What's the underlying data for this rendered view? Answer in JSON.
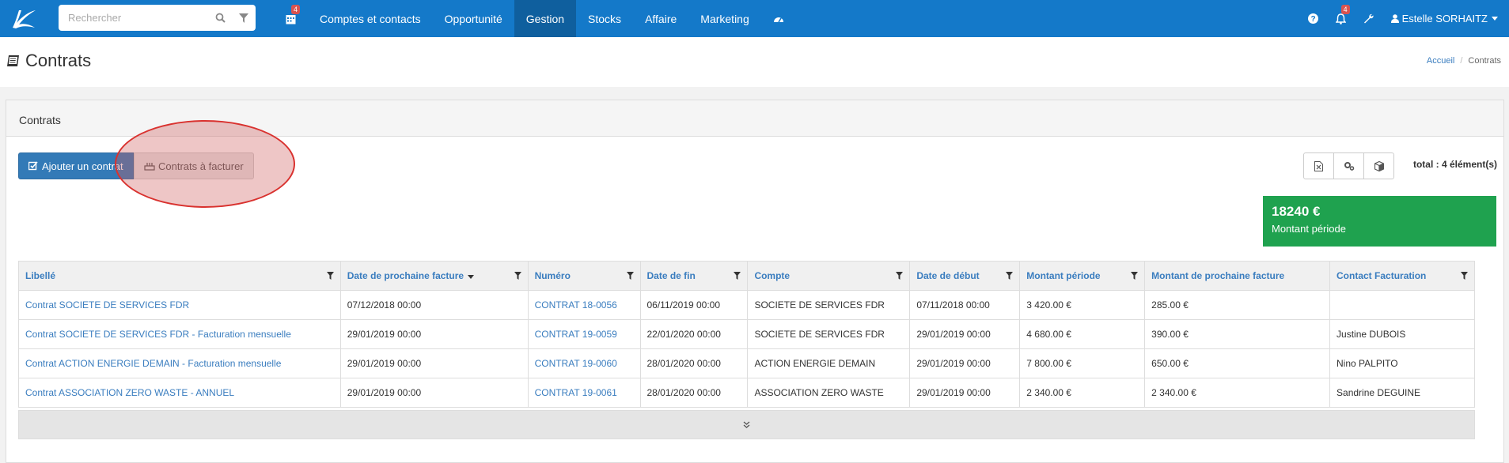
{
  "search": {
    "placeholder": "Rechercher"
  },
  "nav": {
    "calendar_badge": "4",
    "items": [
      {
        "label": "Comptes et contacts"
      },
      {
        "label": "Opportunité"
      },
      {
        "label": "Gestion"
      },
      {
        "label": "Stocks"
      },
      {
        "label": "Affaire"
      },
      {
        "label": "Marketing"
      }
    ]
  },
  "right_nav": {
    "notifications_badge": "4",
    "user_name": "Estelle SORHAITZ"
  },
  "page": {
    "title": "Contrats"
  },
  "breadcrumb": {
    "home": "Accueil",
    "current": "Contrats"
  },
  "panel": {
    "title": "Contrats"
  },
  "toolbar": {
    "add_label": "Ajouter un contrat",
    "bill_label": "Contrats à facturer",
    "total": "total : 4 élément(s)"
  },
  "stat": {
    "value": "18240 €",
    "label": "Montant période"
  },
  "table": {
    "headers": [
      "Libellé",
      "Date de prochaine facture",
      "Numéro",
      "Date de fin",
      "Compte",
      "Date de début",
      "Montant période",
      "Montant de prochaine facture",
      "Contact Facturation"
    ],
    "rows": [
      [
        "Contrat SOCIETE DE SERVICES FDR",
        "07/12/2018 00:00",
        "CONTRAT 18-0056",
        "06/11/2019 00:00",
        "SOCIETE DE SERVICES FDR",
        "07/11/2018 00:00",
        "3 420.00 €",
        "285.00 €",
        ""
      ],
      [
        "Contrat SOCIETE DE SERVICES FDR - Facturation mensuelle",
        "29/01/2019 00:00",
        "CONTRAT 19-0059",
        "22/01/2020 00:00",
        "SOCIETE DE SERVICES FDR",
        "29/01/2019 00:00",
        "4 680.00 €",
        "390.00 €",
        "Justine DUBOIS"
      ],
      [
        "Contrat ACTION ENERGIE DEMAIN - Facturation mensuelle",
        "29/01/2019 00:00",
        "CONTRAT 19-0060",
        "28/01/2020 00:00",
        "ACTION ENERGIE DEMAIN",
        "29/01/2019 00:00",
        "7 800.00 €",
        "650.00 €",
        "Nino PALPITO"
      ],
      [
        "Contrat ASSOCIATION ZERO WASTE - ANNUEL",
        "29/01/2019 00:00",
        "CONTRAT 19-0061",
        "28/01/2020 00:00",
        "ASSOCIATION ZERO WASTE",
        "29/01/2019 00:00",
        "2 340.00 €",
        "2 340.00 €",
        "Sandrine DEGUINE"
      ]
    ]
  },
  "colors": {
    "topbar": "#1479c9",
    "active_nav": "#0f5f9e",
    "primary_button": "#337ab7",
    "stat_box": "#1fa24f",
    "link": "#3a7dbf",
    "highlight": "#d9322f"
  }
}
